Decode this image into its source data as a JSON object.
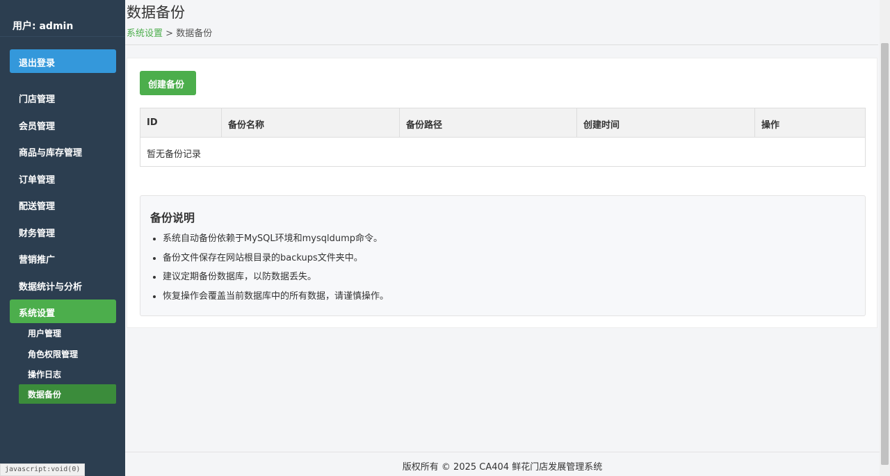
{
  "sidebar": {
    "user": "用户: admin",
    "logout": "退出登录",
    "menu": [
      {
        "label": "门店管理"
      },
      {
        "label": "会员管理"
      },
      {
        "label": "商品与库存管理"
      },
      {
        "label": "订单管理"
      },
      {
        "label": "配送管理"
      },
      {
        "label": "财务管理"
      },
      {
        "label": "营销推广"
      },
      {
        "label": "数据统计与分析"
      },
      {
        "label": "系统设置"
      }
    ],
    "submenu": [
      {
        "label": "用户管理"
      },
      {
        "label": "角色权限管理"
      },
      {
        "label": "操作日志"
      },
      {
        "label": "数据备份"
      }
    ]
  },
  "statusbar": "javascript:void(0)",
  "page": {
    "title": "数据备份",
    "breadcrumb_link": "系统设置",
    "breadcrumb_sep": " > ",
    "breadcrumb_current": "数据备份"
  },
  "actions": {
    "create_backup": "创建备份"
  },
  "table": {
    "headers": [
      "ID",
      "备份名称",
      "备份路径",
      "创建时间",
      "操作"
    ],
    "empty_text": "暂无备份记录"
  },
  "note": {
    "title": "备份说明",
    "items": [
      "系统自动备份依赖于MySQL环境和mysqldump命令。",
      "备份文件保存在网站根目录的backups文件夹中。",
      "建议定期备份数据库，以防数据丢失。",
      "恢复操作会覆盖当前数据库中的所有数据，请谨慎操作。"
    ]
  },
  "footer": "版权所有 © 2025 CA404 鲜花门店发展管理系统",
  "colors": {
    "sidebar_bg": "#2c3e50",
    "primary": "#3498db",
    "success": "#4cae4c",
    "active_sub": "#3b8c3b"
  }
}
